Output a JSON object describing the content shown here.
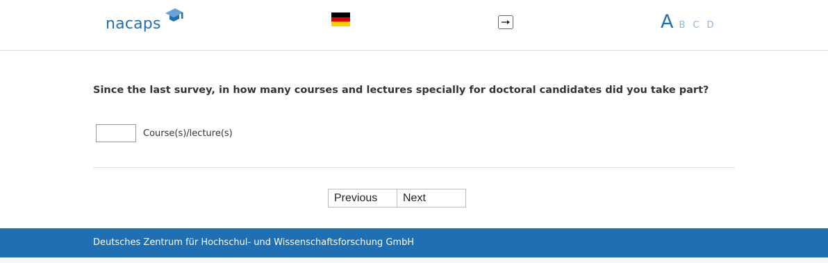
{
  "header": {
    "logo_text": "nacaps",
    "flag": {
      "name": "german-flag",
      "colors": [
        "#000000",
        "#dd0000",
        "#ffce00"
      ]
    },
    "font_sizes": [
      "A",
      "B",
      "C",
      "D"
    ]
  },
  "main": {
    "question": "Since the last survey, in how many courses and lectures specially for doctoral candidates did you take part?",
    "answer": {
      "value": "",
      "unit_label": "Course(s)/lecture(s)"
    },
    "nav": {
      "previous": "Previous",
      "next": "Next"
    }
  },
  "footer": {
    "text": "Deutsches Zentrum für Hochschul- und Wissenschaftsforschung GmbH"
  },
  "colors": {
    "brand_blue": "#1f6fb2",
    "light_blue": "#8ab6dd"
  }
}
